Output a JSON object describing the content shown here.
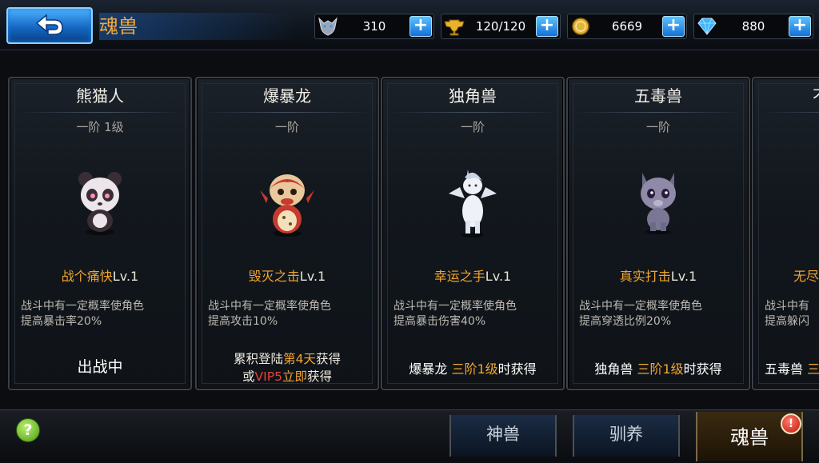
{
  "header": {
    "title": "魂兽",
    "resources": [
      {
        "icon": "wolf-head-icon",
        "value": "310"
      },
      {
        "icon": "stamina-trophy-icon",
        "value": "120/120"
      },
      {
        "icon": "gold-coin-icon",
        "value": "6669"
      },
      {
        "icon": "diamond-icon",
        "value": "880"
      }
    ]
  },
  "cards": [
    {
      "name": "熊猫人",
      "tier": "一阶 1级",
      "pet_icon": "panda-pet-icon",
      "skill_name": "战个痛快",
      "skill_level": "Lv.1",
      "desc_line1": "战斗中有一定概率使角色",
      "desc_line2": "提高暴击率20%",
      "status": "出战中"
    },
    {
      "name": "爆暴龙",
      "tier": "一阶",
      "pet_icon": "dragon-pet-icon",
      "skill_name": "毁灭之击",
      "skill_level": "Lv.1",
      "desc_line1": "战斗中有一定概率使角色",
      "desc_line2": "提高攻击10%",
      "cond_a1": "累积登陆",
      "cond_a2": "第4天",
      "cond_a3": "获得",
      "cond_b1": "或",
      "cond_b2": "VIP5",
      "cond_b3": "立即",
      "cond_b4": "获得"
    },
    {
      "name": "独角兽",
      "tier": "一阶",
      "pet_icon": "unicorn-pet-icon",
      "skill_name": "幸运之手",
      "skill_level": "Lv.1",
      "desc_line1": "战斗中有一定概率使角色",
      "desc_line2": "提高暴击伤害40%",
      "cond_p1": "爆暴龙 ",
      "cond_p2": "三阶1级",
      "cond_p3": "时获得"
    },
    {
      "name": "五毒兽",
      "tier": "一阶",
      "pet_icon": "wolf-pet-icon",
      "skill_name": "真实打击",
      "skill_level": "Lv.1",
      "desc_line1": "战斗中有一定概率使角色",
      "desc_line2": "提高穿透比例20%",
      "cond_p1": "独角兽 ",
      "cond_p2": "三阶1级",
      "cond_p3": "时获得"
    },
    {
      "name": "不",
      "skill_name": "无尽",
      "desc_line1": "战斗中有",
      "desc_line2": "提高躲闪",
      "cond_p1": "五毒兽 ",
      "cond_p2": "三"
    }
  ],
  "bottom": {
    "help_label": "?",
    "tabs": [
      "神兽",
      "驯养",
      "魂兽"
    ],
    "badge": "!"
  }
}
